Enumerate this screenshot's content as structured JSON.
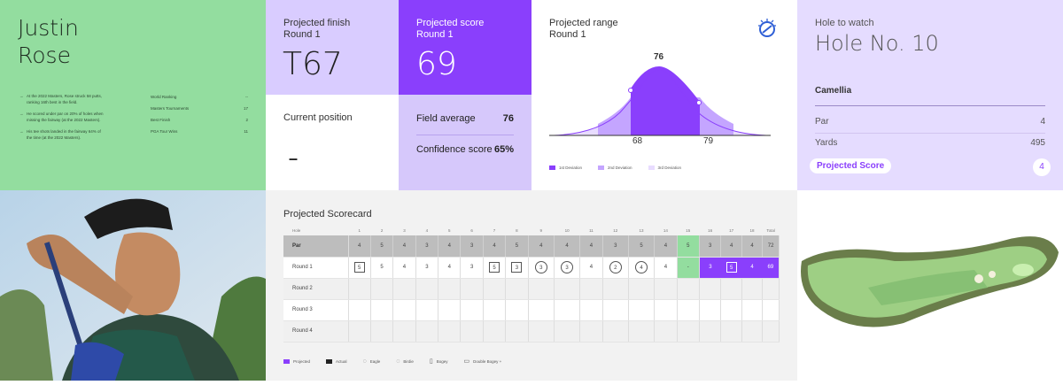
{
  "player": {
    "first_name": "Justin",
    "last_name": "Rose",
    "bullets": [
      "At the 2022 Masters, Rose struck 58 putts, ranking 16th best in the field.",
      "He scored under par on 20% of holes when missing the fairway (at the 2022 Masters).",
      "His tee shots landed in the fairway 64% of the time (at the 2022 Masters)."
    ],
    "stats": [
      {
        "label": "World Ranking",
        "value": "--"
      },
      {
        "label": "Masters Tournaments",
        "value": "17"
      },
      {
        "label": "Best Finish",
        "value": "2"
      },
      {
        "label": "PGA Tour Wins",
        "value": "11"
      }
    ]
  },
  "projected_finish": {
    "label": "Projected finish",
    "round": "Round 1",
    "value": "T67"
  },
  "current_position": {
    "label": "Current position",
    "value": "–"
  },
  "projected_score": {
    "label": "Projected score",
    "round": "Round 1",
    "value": "69"
  },
  "field_average": {
    "label": "Field average",
    "value": "76"
  },
  "confidence": {
    "label": "Confidence score",
    "value": "65%"
  },
  "projected_range": {
    "label": "Projected range",
    "round": "Round 1",
    "peak": "76",
    "low": "68",
    "high": "79",
    "legend": [
      "1st Deviation",
      "2nd Deviation",
      "3rd Deviation"
    ]
  },
  "hole": {
    "label": "Hole to watch",
    "title": "Hole No. 10",
    "name": "Camellia",
    "par_label": "Par",
    "par": "4",
    "yards_label": "Yards",
    "yards": "495",
    "proj_label": "Projected Score",
    "proj": "4"
  },
  "scorecard": {
    "title": "Projected Scorecard",
    "hole_label": "Hole",
    "holes": [
      "1",
      "2",
      "3",
      "4",
      "5",
      "6",
      "7",
      "8",
      "9",
      "10",
      "11",
      "12",
      "13",
      "14",
      "15",
      "16",
      "17",
      "18"
    ],
    "total_label": "Total",
    "par_label": "Par",
    "par": [
      "4",
      "5",
      "4",
      "3",
      "4",
      "3",
      "4",
      "5",
      "4",
      "4",
      "4",
      "3",
      "5",
      "4",
      "5",
      "3",
      "4",
      "4"
    ],
    "par_total": "72",
    "rounds": [
      {
        "label": "Round 1",
        "scores": [
          "5",
          "5",
          "4",
          "3",
          "4",
          "3",
          "5",
          "3",
          "3",
          "3",
          "4",
          "2",
          "4",
          "4",
          "-",
          "3",
          "5",
          "4"
        ],
        "total": "69"
      },
      {
        "label": "Round 2",
        "scores": [],
        "total": ""
      },
      {
        "label": "Round 3",
        "scores": [],
        "total": ""
      },
      {
        "label": "Round 4",
        "scores": [],
        "total": ""
      }
    ],
    "legend": [
      "Projected",
      "Actual",
      "Eagle",
      "Birdie",
      "Bogey",
      "Double Bogey +"
    ]
  },
  "colors": {
    "green": "#93dd9f",
    "purple": "#8a3ffc",
    "lavender": "#d9ccff",
    "light_lavender": "#e5dcff"
  }
}
